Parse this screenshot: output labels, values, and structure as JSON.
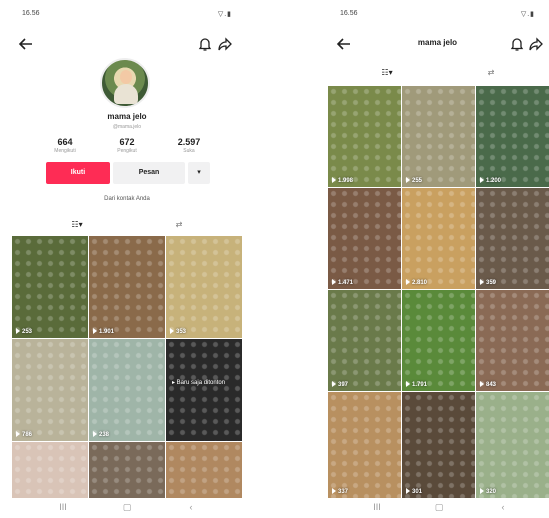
{
  "left": {
    "status_time": "16.56",
    "status_sys": "▽.▮",
    "username": "mama jelo",
    "handle": "@mama.jelo",
    "stats": [
      {
        "value": "664",
        "label": "Mengikuti"
      },
      {
        "value": "672",
        "label": "Pengikut"
      },
      {
        "value": "2.597",
        "label": "Suka"
      }
    ],
    "follow_label": "Ikuti",
    "message_label": "Pesan",
    "more_label": "▾",
    "contact_note": "Dari kontak Anda",
    "tab_grid": "☷▾",
    "tab_repost": "⇄",
    "videos": [
      {
        "count": "253",
        "color": "#5a6b3a"
      },
      {
        "count": "1.901",
        "color": "#8a6a4a"
      },
      {
        "count": "353",
        "color": "#c7b27a"
      },
      {
        "count": "786",
        "color": "#b9b39a"
      },
      {
        "count": "238",
        "color": "#9fb5a8"
      },
      {
        "count": "",
        "color": "#2a2a2a",
        "watched": "▸ Baru saja ditonton"
      },
      {
        "count": "",
        "color": "#d9c4b7"
      },
      {
        "count": "",
        "color": "#7a6a5a"
      },
      {
        "count": "",
        "color": "#b08860"
      }
    ]
  },
  "right": {
    "status_time": "16.56",
    "status_sys": "▽.▮",
    "title": "mama jelo",
    "tab_grid": "☷▾",
    "tab_repost": "⇄",
    "videos": [
      {
        "count": "1.998",
        "color": "#7a8a4a"
      },
      {
        "count": "255",
        "color": "#a09a7a"
      },
      {
        "count": "1.200",
        "color": "#4a6a4a"
      },
      {
        "count": "1.471",
        "color": "#7a5a45"
      },
      {
        "count": "2.810",
        "color": "#c9a060"
      },
      {
        "count": "359",
        "color": "#6a5a4a"
      },
      {
        "count": "397",
        "color": "#6a7a4a"
      },
      {
        "count": "1.791",
        "color": "#5a8a3a"
      },
      {
        "count": "843",
        "color": "#8a6a55"
      },
      {
        "count": "337",
        "color": "#b89060"
      },
      {
        "count": "301",
        "color": "#5a4a3a"
      },
      {
        "count": "320",
        "color": "#9ab08a"
      }
    ]
  },
  "nav": {
    "recent": "III",
    "home": "▢",
    "back": "‹"
  }
}
